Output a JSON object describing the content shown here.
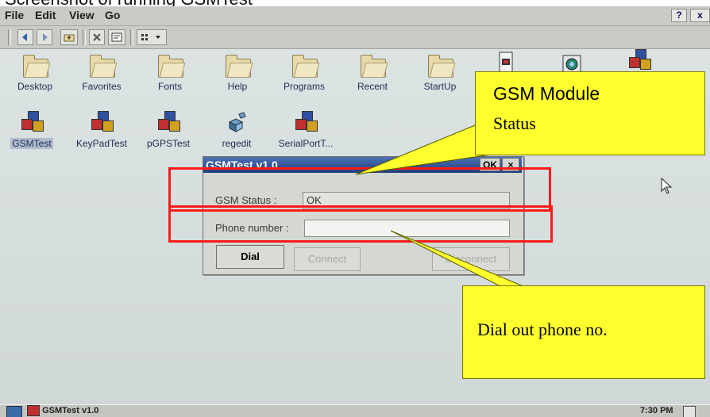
{
  "caption": "Screenshot of running GSMTest",
  "menubar": {
    "items": [
      "File",
      "Edit",
      "View",
      "Go"
    ],
    "help_label": "?",
    "close_label": "x"
  },
  "toolbar": {
    "buttons": [
      "back-icon",
      "forward-icon",
      "up-folder-icon",
      "delete-icon",
      "properties-icon",
      "views-icon"
    ]
  },
  "desktop": {
    "icons": [
      {
        "label": "Desktop",
        "type": "folder"
      },
      {
        "label": "Favorites",
        "type": "folder"
      },
      {
        "label": "Fonts",
        "type": "folder"
      },
      {
        "label": "Help",
        "type": "folder"
      },
      {
        "label": "Programs",
        "type": "folder"
      },
      {
        "label": "Recent",
        "type": "folder"
      },
      {
        "label": "StartUp",
        "type": "folder"
      },
      {
        "label": "",
        "type": "document"
      },
      {
        "label": "",
        "type": "app"
      },
      {
        "label": "",
        "type": "cubes"
      },
      {
        "label": "GSMTest",
        "type": "cubes"
      },
      {
        "label": "KeyPadTest",
        "type": "cubes"
      },
      {
        "label": "pGPSTest",
        "type": "cubes"
      },
      {
        "label": "regedit",
        "type": "registry"
      },
      {
        "label": "SerialPortT...",
        "type": "cubes"
      }
    ]
  },
  "dialog": {
    "title": "GSMTest v1.0",
    "ok_label": "OK",
    "close_label": "×",
    "gsm_status_label": "GSM Status :",
    "gsm_status_value": "OK",
    "phone_label": "Phone number :",
    "phone_value": "",
    "buttons": {
      "dial": "Dial",
      "connect": "Connect",
      "disconnect": "Disconnect"
    }
  },
  "annotations": {
    "callout_top_line1": "GSM Module",
    "callout_top_line2": "Status",
    "callout_bottom": "Dial out phone no.",
    "colors": {
      "box": "#ff1a1a",
      "callout": "#ffff2e"
    }
  },
  "taskbar": {
    "task_label": "GSMTest v1.0",
    "clock": "7:30 PM"
  }
}
